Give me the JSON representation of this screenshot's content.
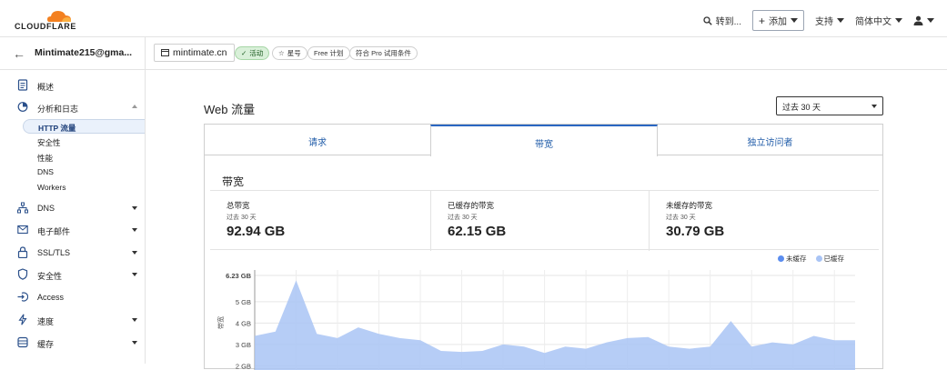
{
  "topbar": {
    "logo_text": "CLOUDFLARE",
    "goto_label": "转到...",
    "add_label": "添加",
    "support_label": "支持",
    "language_label": "简体中文"
  },
  "sidebar": {
    "account": "Mintimate215@gma...",
    "items": [
      {
        "label": "概述",
        "icon": "document-icon"
      },
      {
        "label": "分析和日志",
        "icon": "clock-chart-icon",
        "expanded": true
      },
      {
        "label": "DNS",
        "icon": "network-icon"
      },
      {
        "label": "电子邮件",
        "icon": "envelope-icon"
      },
      {
        "label": "SSL/TLS",
        "icon": "lock-icon"
      },
      {
        "label": "安全性",
        "icon": "shield-icon"
      },
      {
        "label": "Access",
        "icon": "login-icon"
      },
      {
        "label": "速度",
        "icon": "lightning-icon"
      },
      {
        "label": "缓存",
        "icon": "database-icon"
      }
    ],
    "sub_items": [
      "HTTP 流量",
      "安全性",
      "性能",
      "DNS",
      "Workers"
    ],
    "active_sub": "HTTP 流量"
  },
  "zonebar": {
    "domain": "mintimate.cn",
    "status": "活动",
    "star": "星号",
    "plan": "Free 计划",
    "pro": "符合 Pro 试用条件"
  },
  "main": {
    "title": "Web 流量",
    "range": "过去 30 天",
    "tabs": [
      "请求",
      "带宽",
      "独立访问者"
    ],
    "active_tab": "带宽",
    "section_title": "带宽",
    "stats": [
      {
        "title": "总带宽",
        "sub": "过去 30 天",
        "value": "92.94 GB"
      },
      {
        "title": "已缓存的带宽",
        "sub": "过去 30 天",
        "value": "62.15 GB"
      },
      {
        "title": "未缓存的带宽",
        "sub": "过去 30 天",
        "value": "30.79 GB"
      }
    ]
  },
  "chart_data": {
    "type": "area",
    "ylabel": "带宽",
    "y_ticks": [
      "6.23 GB",
      "5 GB",
      "4 GB",
      "3 GB",
      "2 GB"
    ],
    "y_tick_values": [
      6.23,
      5,
      4,
      3,
      2
    ],
    "legend": [
      "未缓存",
      "已缓存"
    ],
    "legend_position": "top-right",
    "series": [
      {
        "name": "未缓存",
        "color": "#5b8def",
        "values": []
      },
      {
        "name": "已缓存",
        "color": "#a9c4f5",
        "values": [
          3.4,
          3.6,
          6.0,
          3.5,
          3.3,
          3.8,
          3.5,
          3.3,
          3.2,
          2.7,
          2.65,
          2.7,
          3.0,
          2.9,
          2.6,
          2.9,
          2.8,
          3.1,
          3.3,
          3.35,
          2.9,
          2.8,
          2.9,
          4.1,
          2.9,
          3.1,
          3.0,
          3.4,
          3.2,
          3.2
        ]
      }
    ],
    "grid": true
  }
}
